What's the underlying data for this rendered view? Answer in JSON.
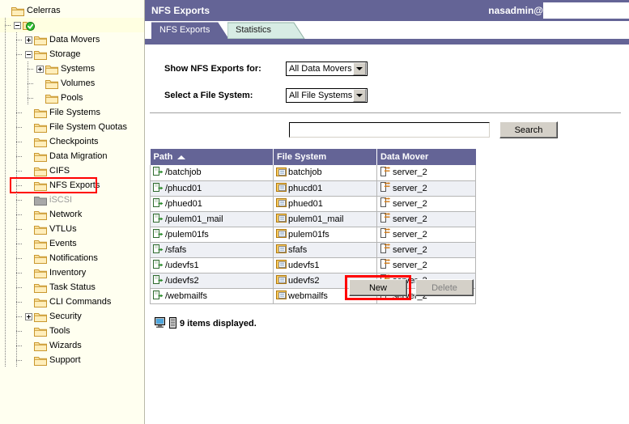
{
  "colors": {
    "accent_purple": "#646496",
    "sidebar_bg": "#fffff0",
    "tab_inactive": "#d7ece4",
    "highlight_red": "#ff0000",
    "row_alt": "#eef0f5"
  },
  "sidebar": {
    "root_label": "Celerras",
    "items": [
      {
        "label": "Celerras",
        "depth": 0,
        "toggle": "none",
        "icon": "folder-icon"
      },
      {
        "label": "",
        "depth": 1,
        "toggle": "minus",
        "icon": "green-check-icon",
        "highlighted": true
      },
      {
        "label": "Data Movers",
        "depth": 2,
        "toggle": "plus",
        "icon": "folder-icon"
      },
      {
        "label": "Storage",
        "depth": 2,
        "toggle": "minus",
        "icon": "folder-icon"
      },
      {
        "label": "Systems",
        "depth": 3,
        "toggle": "plus",
        "icon": "folder-icon"
      },
      {
        "label": "Volumes",
        "depth": 3,
        "toggle": "none",
        "icon": "folder-icon"
      },
      {
        "label": "Pools",
        "depth": 3,
        "toggle": "none",
        "icon": "folder-icon"
      },
      {
        "label": "File Systems",
        "depth": 2,
        "toggle": "none",
        "icon": "folder-icon"
      },
      {
        "label": "File System Quotas",
        "depth": 2,
        "toggle": "none",
        "icon": "folder-icon"
      },
      {
        "label": "Checkpoints",
        "depth": 2,
        "toggle": "none",
        "icon": "folder-icon"
      },
      {
        "label": "Data Migration",
        "depth": 2,
        "toggle": "none",
        "icon": "folder-icon"
      },
      {
        "label": "CIFS",
        "depth": 2,
        "toggle": "none",
        "icon": "folder-icon"
      },
      {
        "label": "NFS Exports",
        "depth": 2,
        "toggle": "none",
        "icon": "folder-icon",
        "selected": true
      },
      {
        "label": "iSCSI",
        "depth": 2,
        "toggle": "none",
        "icon": "folder-disabled-icon",
        "disabled": true
      },
      {
        "label": "Network",
        "depth": 2,
        "toggle": "none",
        "icon": "folder-icon"
      },
      {
        "label": "VTLUs",
        "depth": 2,
        "toggle": "none",
        "icon": "folder-icon"
      },
      {
        "label": "Events",
        "depth": 2,
        "toggle": "none",
        "icon": "folder-icon"
      },
      {
        "label": "Notifications",
        "depth": 2,
        "toggle": "none",
        "icon": "folder-icon"
      },
      {
        "label": "Inventory",
        "depth": 2,
        "toggle": "none",
        "icon": "folder-icon"
      },
      {
        "label": "Task Status",
        "depth": 2,
        "toggle": "none",
        "icon": "folder-icon"
      },
      {
        "label": "CLI Commands",
        "depth": 2,
        "toggle": "none",
        "icon": "folder-icon"
      },
      {
        "label": "Security",
        "depth": 2,
        "toggle": "plus",
        "icon": "folder-icon"
      },
      {
        "label": "Tools",
        "depth": 2,
        "toggle": "none",
        "icon": "folder-icon"
      },
      {
        "label": "Wizards",
        "depth": 2,
        "toggle": "none",
        "icon": "folder-icon"
      },
      {
        "label": "Support",
        "depth": 2,
        "toggle": "none",
        "icon": "folder-icon"
      }
    ]
  },
  "header": {
    "title": "NFS Exports",
    "user": "nasadmin@"
  },
  "tabs": [
    {
      "label": "NFS Exports",
      "active": true
    },
    {
      "label": "Statistics",
      "active": false
    }
  ],
  "filters": [
    {
      "label": "Show NFS Exports for:",
      "value": "All Data Movers"
    },
    {
      "label": "Select a File System:",
      "value": "All File Systems"
    }
  ],
  "search": {
    "value": "",
    "placeholder": "",
    "button_label": "Search"
  },
  "table": {
    "columns": [
      {
        "label": "Path",
        "sorted": "asc"
      },
      {
        "label": "File System",
        "sorted": ""
      },
      {
        "label": "Data Mover",
        "sorted": ""
      }
    ],
    "rows": [
      {
        "path": "/batchjob",
        "file_system": "batchjob",
        "data_mover": "server_2"
      },
      {
        "path": "/phucd01",
        "file_system": "phucd01",
        "data_mover": "server_2"
      },
      {
        "path": "/phued01",
        "file_system": "phued01",
        "data_mover": "server_2"
      },
      {
        "path": "/pulem01_mail",
        "file_system": "pulem01_mail",
        "data_mover": "server_2"
      },
      {
        "path": "/pulem01fs",
        "file_system": "pulem01fs",
        "data_mover": "server_2"
      },
      {
        "path": "/sfafs",
        "file_system": "sfafs",
        "data_mover": "server_2"
      },
      {
        "path": "/udevfs1",
        "file_system": "udevfs1",
        "data_mover": "server_2"
      },
      {
        "path": "/udevfs2",
        "file_system": "udevfs2",
        "data_mover": "server_2"
      },
      {
        "path": "/webmailfs",
        "file_system": "webmailfs",
        "data_mover": "server_2"
      }
    ]
  },
  "status": {
    "text": "9 items displayed."
  },
  "footer": {
    "new_label": "New",
    "delete_label": "Delete",
    "delete_disabled": true,
    "new_highlighted": true
  }
}
